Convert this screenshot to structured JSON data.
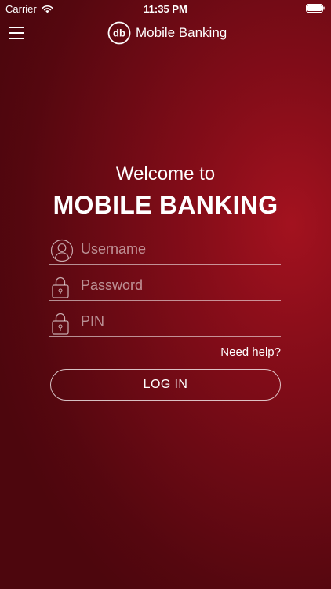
{
  "status_bar": {
    "carrier": "Carrier",
    "time": "11:35 PM",
    "wifi_icon": "wifi-icon",
    "battery_icon": "battery-icon"
  },
  "nav": {
    "menu_icon": "hamburger-menu-icon",
    "logo_text": "db",
    "title": "Mobile Banking"
  },
  "welcome": {
    "line1": "Welcome to",
    "headline": "MOBILE BANKING"
  },
  "form": {
    "username": {
      "placeholder": "Username",
      "value": "",
      "icon": "user-icon"
    },
    "password": {
      "placeholder": "Password",
      "value": "",
      "icon": "lock-icon"
    },
    "pin": {
      "placeholder": "PIN",
      "value": "",
      "icon": "lock-icon"
    },
    "help_label": "Need help?",
    "login_label": "LOG IN"
  },
  "colors": {
    "background_center": "#a3121f",
    "background_edge": "#4d060d",
    "text": "#ffffff"
  }
}
